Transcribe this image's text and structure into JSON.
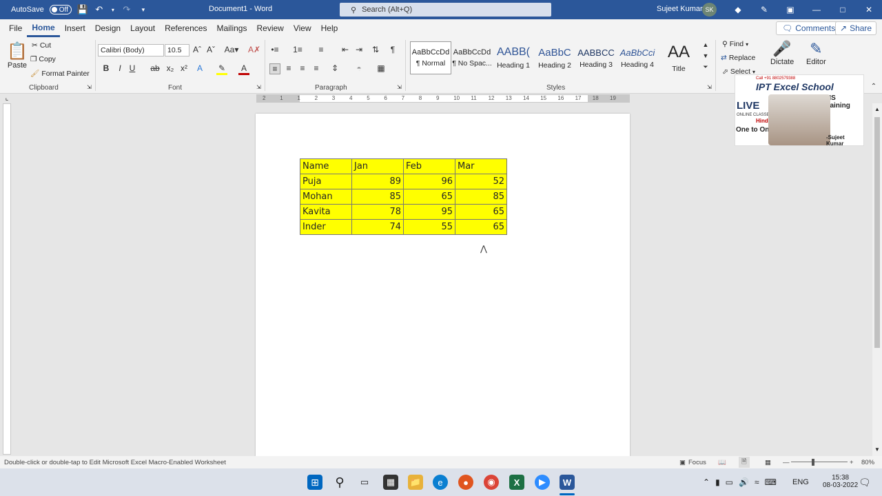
{
  "titlebar": {
    "autosave_label": "AutoSave",
    "autosave_state": "Off",
    "doc_title": "Document1  -  Word",
    "search_placeholder": "Search (Alt+Q)",
    "user_name": "Sujeet Kumar",
    "user_initials": "SK"
  },
  "menu": {
    "tabs": [
      "File",
      "Home",
      "Insert",
      "Design",
      "Layout",
      "References",
      "Mailings",
      "Review",
      "View",
      "Help"
    ],
    "active": "Home",
    "comments": "Comments",
    "share": "Share"
  },
  "ribbon": {
    "clipboard": {
      "paste": "Paste",
      "cut": "Cut",
      "copy": "Copy",
      "format_painter": "Format Painter",
      "label": "Clipboard"
    },
    "font": {
      "family": "Calibri (Body)",
      "size": "10.5",
      "label": "Font"
    },
    "paragraph": {
      "label": "Paragraph"
    },
    "styles": {
      "items": [
        {
          "preview": "AaBbCcDd",
          "label": "¶ Normal"
        },
        {
          "preview": "AaBbCcDd",
          "label": "¶ No Spac..."
        },
        {
          "preview": "AABB(",
          "label": "Heading 1"
        },
        {
          "preview": "AaBbC",
          "label": "Heading 2"
        },
        {
          "preview": "AABBCC",
          "label": "Heading 3"
        },
        {
          "preview": "AaBbCci",
          "label": "Heading 4"
        },
        {
          "preview": "AA",
          "label": "Title"
        }
      ],
      "label": "Styles"
    },
    "editing": {
      "find": "Find",
      "replace": "Replace",
      "select": "Select"
    },
    "voice": {
      "dictate": "Dictate"
    },
    "editor": {
      "label": "Editor"
    }
  },
  "table": {
    "header": [
      "Name",
      "Jan",
      "Feb",
      "Mar"
    ],
    "rows": [
      [
        "Puja",
        "89",
        "96",
        "52"
      ],
      [
        "Mohan",
        "85",
        "65",
        "85"
      ],
      [
        "Kavita",
        "78",
        "95",
        "65"
      ],
      [
        "Inder",
        "74",
        "55",
        "65"
      ]
    ],
    "fill_color": "#ffff00"
  },
  "ruler": {
    "ticks": [
      "2",
      "1",
      "1",
      "2",
      "3",
      "4",
      "5",
      "6",
      "7",
      "8",
      "9",
      "10",
      "11",
      "12",
      "13",
      "14",
      "15",
      "16",
      "17",
      "18",
      "19"
    ]
  },
  "overlay": {
    "phone": "Call +91 8802579388",
    "brand": "IPT Excel School",
    "training": "MIS Training",
    "live": "LIVE",
    "online": "ONLINE CLASSES",
    "hindi": "Hindi",
    "one": "One to One",
    "presenter": "-Sujeet Kumar"
  },
  "status": {
    "message": "Double-click or double-tap to Edit Microsoft Excel Macro-Enabled Worksheet",
    "focus": "Focus",
    "zoom": "80%"
  },
  "taskbar": {
    "lang": "ENG",
    "time": "15:38",
    "date": "08-03-2022"
  }
}
